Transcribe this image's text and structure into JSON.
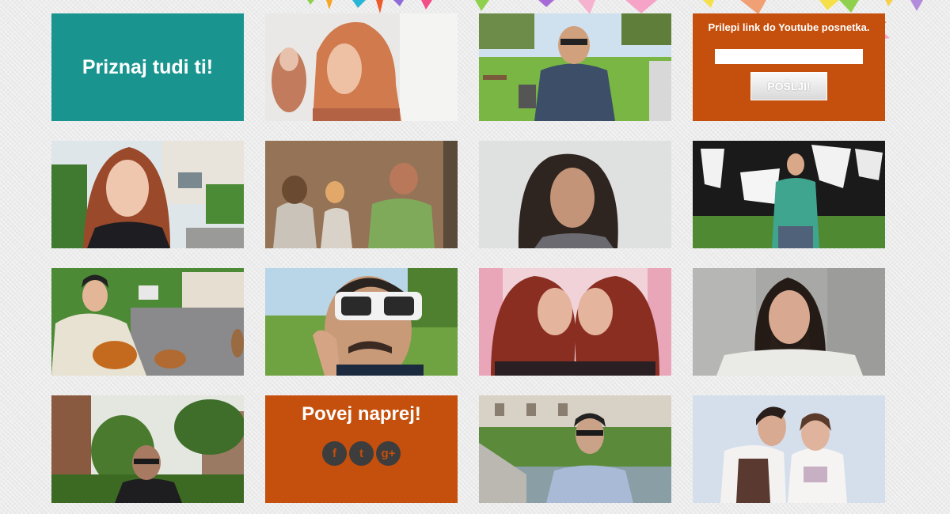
{
  "header_tile": {
    "title": "Priznaj tudi ti!"
  },
  "submit_tile": {
    "label": "Prilepi link do Youtube posnetka.",
    "input_value": "",
    "button_label": "POŠLJI!"
  },
  "share_tile": {
    "title": "Povej naprej!",
    "icons": [
      {
        "name": "facebook-icon",
        "glyph": "f"
      },
      {
        "name": "twitter-icon",
        "glyph": "t"
      },
      {
        "name": "google-plus-icon",
        "glyph": "g+"
      }
    ]
  },
  "colors": {
    "teal": "#19948f",
    "orange": "#c54f0c",
    "background": "#ececec"
  }
}
